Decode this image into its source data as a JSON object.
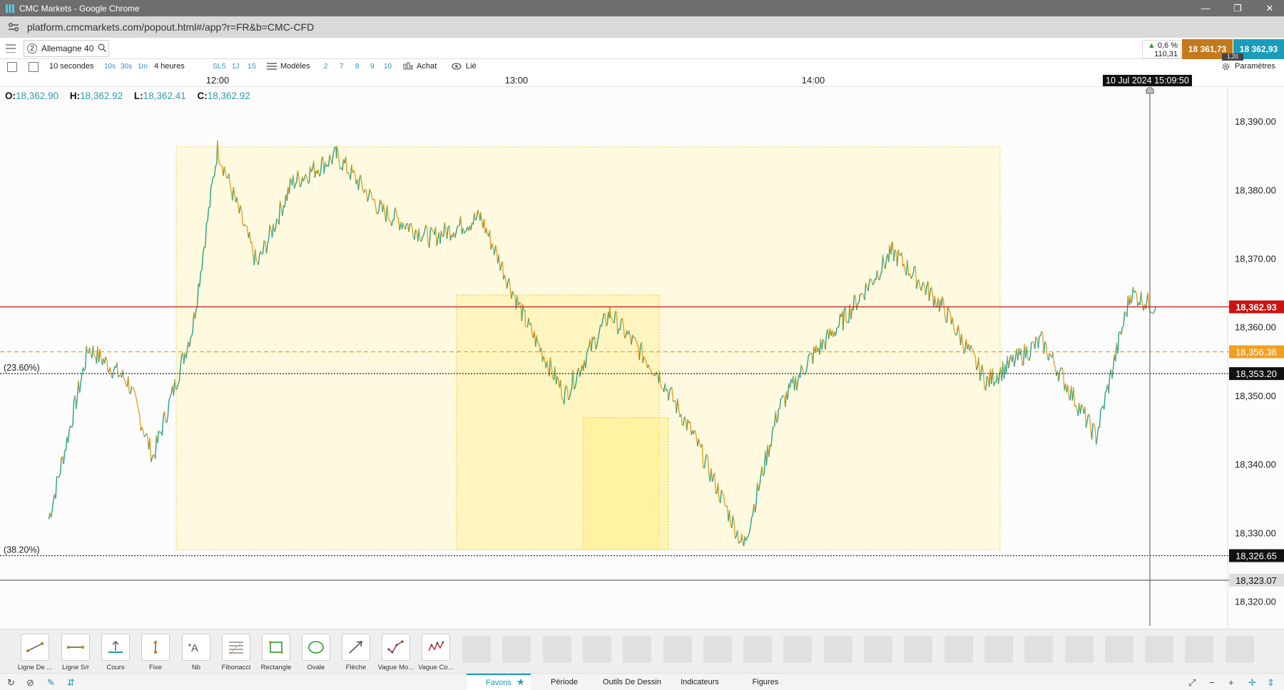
{
  "window": {
    "title": "CMC Markets - Google Chrome",
    "url": "platform.cmcmarkets.com/popout.html#/app?r=FR&b=CMC-CFD"
  },
  "header": {
    "instrument_number": "2",
    "instrument_name": "Allemagne 40",
    "change_pct": "0,6 %",
    "change_pts": "110,31",
    "sell_price": "18 361,73",
    "buy_price": "18 362,93",
    "spread": "1,20"
  },
  "toolbar": {
    "interval": "10 secondes",
    "quick_intervals": [
      "10s",
      "30s",
      "1m"
    ],
    "range": "4 heures",
    "quick_ranges": [
      "SLS",
      "1J",
      "1S"
    ],
    "templates_label": "Modèles",
    "presets": [
      "2",
      "7",
      "8",
      "9",
      "10"
    ],
    "buy_label": "Achat",
    "link_label": "Lié",
    "settings_label": "Paramètres"
  },
  "ohlc": {
    "o_label": "O:",
    "o": "18,362.90",
    "h_label": "H:",
    "h": "18,362.92",
    "l_label": "L:",
    "l": "18,362.41",
    "c_label": "C:",
    "c": "18,362.92"
  },
  "time_axis": {
    "ticks": [
      "12:00",
      "13:00",
      "14:00"
    ],
    "cursor_time": "10 Jul 2024 15:09:50"
  },
  "chart_data": {
    "type": "line",
    "ylim": [
      18316,
      18395
    ],
    "y_ticks": [
      18390,
      18380,
      18370,
      18360,
      18350,
      18340,
      18330,
      18320
    ],
    "y_tick_labels": [
      "18,390.00",
      "18,380.00",
      "18,370.00",
      "18,360.00",
      "18,350.00",
      "18,340.00",
      "18,330.00",
      "18,320.00"
    ],
    "colors": {
      "up": "#1fa58c",
      "down": "#f0a020"
    },
    "series": [
      {
        "x": [
          "11:26",
          "11:34",
          "11:42",
          "11:47",
          "11:55",
          "12:00",
          "12:08",
          "12:15",
          "12:24",
          "12:33",
          "12:43",
          "12:53",
          "13:02",
          "13:10",
          "13:19",
          "13:29",
          "13:36",
          "13:46",
          "13:53",
          "13:59",
          "14:06",
          "14:16",
          "14:26",
          "14:35",
          "14:46",
          "14:57",
          "15:04",
          "15:09"
        ],
        "values": [
          18332,
          18357,
          18352,
          18341,
          18360,
          18386,
          18369,
          18381,
          18385,
          18377,
          18373,
          18376,
          18361,
          18350,
          18362,
          18353,
          18344,
          18328,
          18348,
          18355,
          18361,
          18371,
          18363,
          18352,
          18358,
          18344,
          18365,
          18362.9
        ]
      }
    ],
    "price_lines": [
      {
        "value": "18,362.93",
        "color": "#cc1111",
        "style": "solid"
      },
      {
        "value": "18,356.38",
        "color": "#f0a020",
        "style": "dashed"
      },
      {
        "value": "18,353.20",
        "color": "#222222",
        "style": "dotted",
        "label": "(23.60%)"
      },
      {
        "value": "18,326.65",
        "color": "#222222",
        "style": "dotted",
        "label": "(38.20%)"
      },
      {
        "value": "18,323.07",
        "color": "#666666",
        "style": "solid"
      }
    ]
  },
  "drawing_tools": [
    "Ligne De ...",
    "Ligne S/r",
    "Cours",
    "Fixe",
    "Nb",
    "Fibonacci",
    "Rectangle",
    "Ovale",
    "Flèche",
    "Vague Mo...",
    "Vague Co..."
  ],
  "bottom_tabs": [
    "Favoris",
    "Période",
    "Outils De Dessin",
    "Indicateurs",
    "Figures"
  ]
}
